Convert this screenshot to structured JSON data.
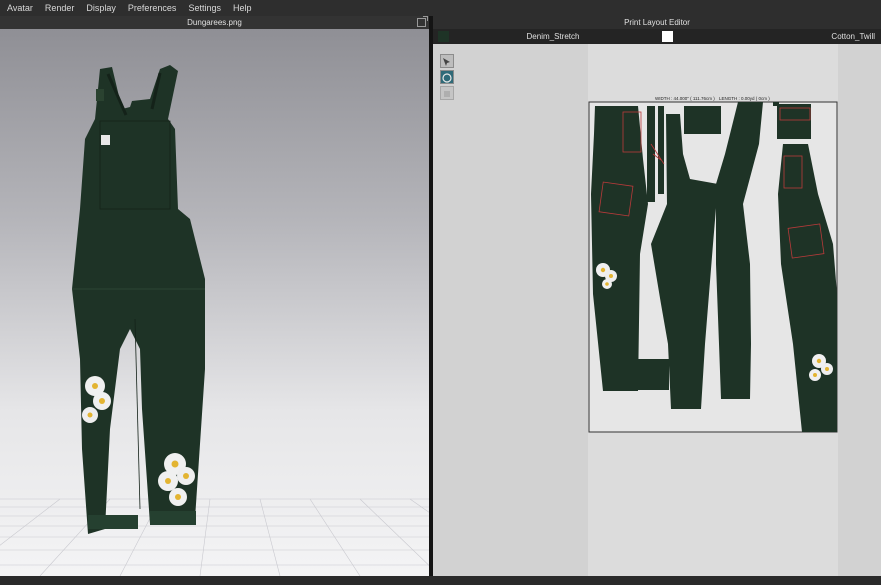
{
  "menu": [
    "Avatar",
    "Render",
    "Display",
    "Preferences",
    "Settings",
    "Help"
  ],
  "left_window": {
    "title": "Dungarees.png"
  },
  "right_window": {
    "title": "Print Layout Editor"
  },
  "fabrics": [
    {
      "name": "Denim_Stretch",
      "color": "#1e3326"
    },
    {
      "name": "Cotton_Twill",
      "color": "#ffffff"
    }
  ],
  "layout": {
    "width_label": "WIDTH : 44.000\" ( 111.76cm )",
    "length_label": "LENGTH : 0.00yd ( 0cm )"
  },
  "colors": {
    "garment": "#1e3326",
    "accent": "#b83a3a"
  }
}
